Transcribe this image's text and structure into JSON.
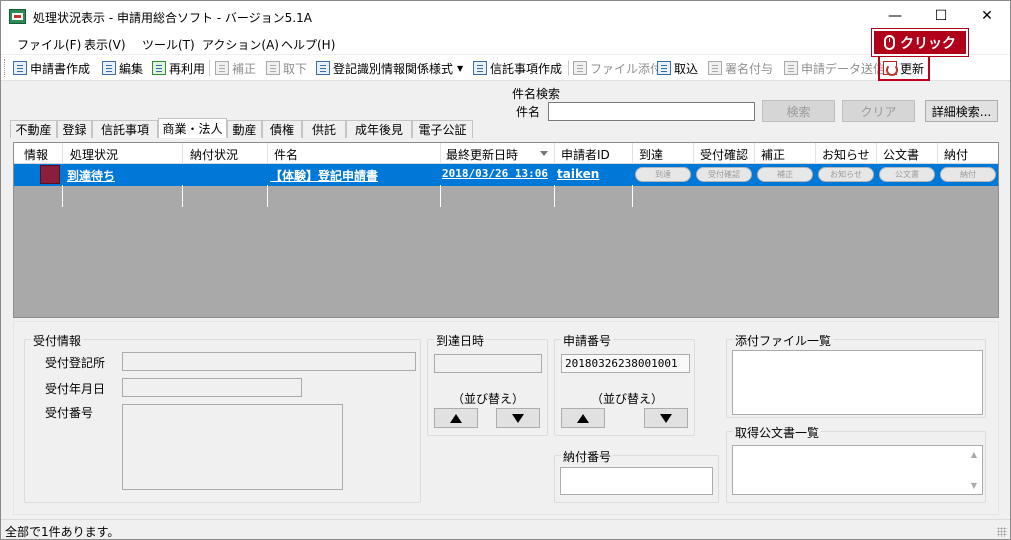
{
  "window": {
    "title": "処理状況表示 - 申請用総合ソフト - バージョン5.1A",
    "minimize": "—",
    "maximize": "☐",
    "close": "✕"
  },
  "menu": [
    "ファイル(F)",
    "表示(V)",
    "ツール(T)",
    "アクション(A)",
    "ヘルプ(H)"
  ],
  "toolbar": {
    "create_application": "申請書作成",
    "edit": "編集",
    "reuse": "再利用",
    "correct": "補正",
    "withdraw": "取下",
    "registration_form": "登記識別情報関係様式",
    "trust_create": "信託事項作成",
    "attach_file": "ファイル添付",
    "import": "取込",
    "sign": "署名付与",
    "send_data": "申請データ送信",
    "refresh": "更新"
  },
  "callout": {
    "label": "クリック"
  },
  "search": {
    "group_title": "件名検索",
    "field_label": "件名",
    "value": "",
    "search_button": "検索",
    "clear_button": "クリア",
    "advanced_button": "詳細検索..."
  },
  "tabs": [
    "不動産",
    "登録",
    "信託事項",
    "商業・法人",
    "動産",
    "債権",
    "供託",
    "成年後見",
    "電子公証"
  ],
  "grid": {
    "columns": [
      "情報",
      "処理状況",
      "納付状況",
      "件名",
      "最終更新日時",
      "申請者ID",
      "到達",
      "受付確認",
      "補正",
      "お知らせ",
      "公文書",
      "納付"
    ],
    "rows": [
      {
        "status": "到達待ち",
        "payment_status": "",
        "subject": "【体験】登記申請書",
        "updated": "2018/03/26 13:06",
        "applicant_id": "taiken",
        "arrival": "到達",
        "receipt_confirm": "受付確認",
        "correction": "補正",
        "notice": "お知らせ",
        "official_doc": "公文書",
        "payment": "納付"
      }
    ]
  },
  "detail": {
    "reception": {
      "title": "受付情報",
      "office_label": "受付登記所",
      "date_label": "受付年月日",
      "number_label": "受付番号",
      "office_value": "",
      "date_value": "",
      "number_value": ""
    },
    "arrival": {
      "title": "到達日時",
      "value": "",
      "sort_label": "（並び替え）",
      "up": "▲",
      "down": "▼"
    },
    "application_number": {
      "title": "申請番号",
      "value": "20180326238001001",
      "sort_label": "（並び替え）",
      "up": "▲",
      "down": "▼"
    },
    "payment_number": {
      "title": "納付番号",
      "value": ""
    },
    "attachments": {
      "title": "添付ファイル一覧"
    },
    "official_docs": {
      "title": "取得公文書一覧"
    }
  },
  "statusbar": {
    "text": "全部で1件あります。"
  }
}
